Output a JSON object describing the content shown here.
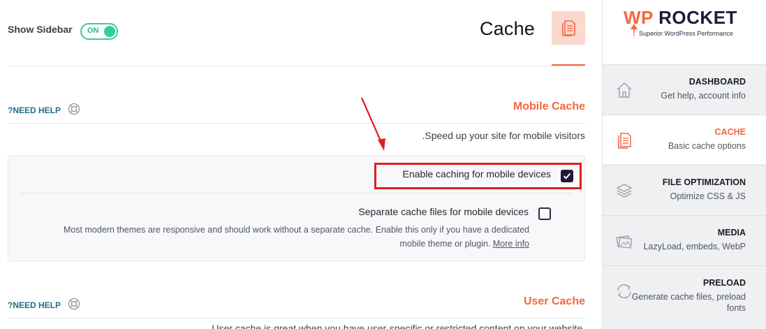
{
  "header": {
    "show_sidebar_label": "Show Sidebar",
    "toggle_state": "ON",
    "page_title": "Cache"
  },
  "mobile_section": {
    "need_help": "?NEED HELP",
    "title": "Mobile Cache",
    "subtitle": ".Speed up your site for mobile visitors",
    "options": [
      {
        "label": "Enable caching for mobile devices",
        "checked": true
      },
      {
        "label": "Separate cache files for mobile devices",
        "checked": false,
        "description_line1": "Most modern themes are responsive and should work without a separate cache. Enable this only if you have a dedicated",
        "description_line2_prefix": "mobile theme or plugin. ",
        "description_link": "More info"
      }
    ]
  },
  "user_section": {
    "need_help": "?NEED HELP",
    "title": "User Cache",
    "subtitle_partial": "User cache is great when you have user-specific or restricted content on your website."
  },
  "brand": {
    "logo_wp": "WP",
    "logo_rocket": "ROCKET",
    "tagline": "Superior WordPress Performance"
  },
  "nav": {
    "items": [
      {
        "title": "DASHBOARD",
        "sub": "Get help, account info",
        "icon": "home-icon",
        "active": false
      },
      {
        "title": "CACHE",
        "sub": "Basic cache options",
        "icon": "document-icon",
        "active": true
      },
      {
        "title": "FILE OPTIMIZATION",
        "sub": "Optimize CSS & JS",
        "icon": "layers-icon",
        "active": false
      },
      {
        "title": "MEDIA",
        "sub": "LazyLoad, embeds, WebP",
        "icon": "images-icon",
        "active": false
      },
      {
        "title": "PRELOAD",
        "sub": "Generate cache files, preload fonts",
        "icon": "refresh-icon",
        "active": false
      }
    ]
  },
  "colors": {
    "accent": "#f56640",
    "toggle_green": "#2fcf9b",
    "help_link": "#1f6d89",
    "annotation_red": "#e31d1d",
    "checkbox_fill": "#1f1840"
  }
}
